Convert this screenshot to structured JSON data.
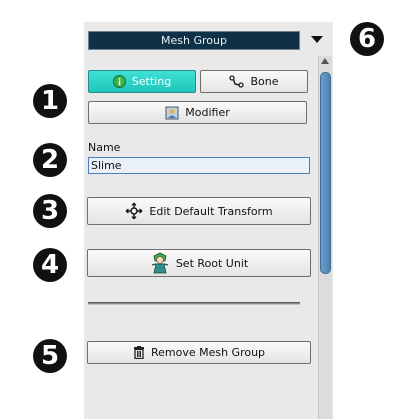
{
  "header": {
    "title": "Mesh Group"
  },
  "tabs": {
    "setting_label": "Setting",
    "bone_label": "Bone",
    "modifier_label": "Modifier"
  },
  "name_section": {
    "label": "Name",
    "value": "Slime"
  },
  "actions": {
    "edit_default_transform": "Edit Default Transform",
    "set_root_unit": "Set Root Unit",
    "remove_mesh_group": "Remove Mesh Group"
  },
  "callouts": [
    "1",
    "2",
    "3",
    "4",
    "5",
    "6"
  ],
  "colors": {
    "header_bg": "#0e3147",
    "active_tab": "#2fd6cb",
    "scroll_thumb": "#5a8fbd"
  }
}
